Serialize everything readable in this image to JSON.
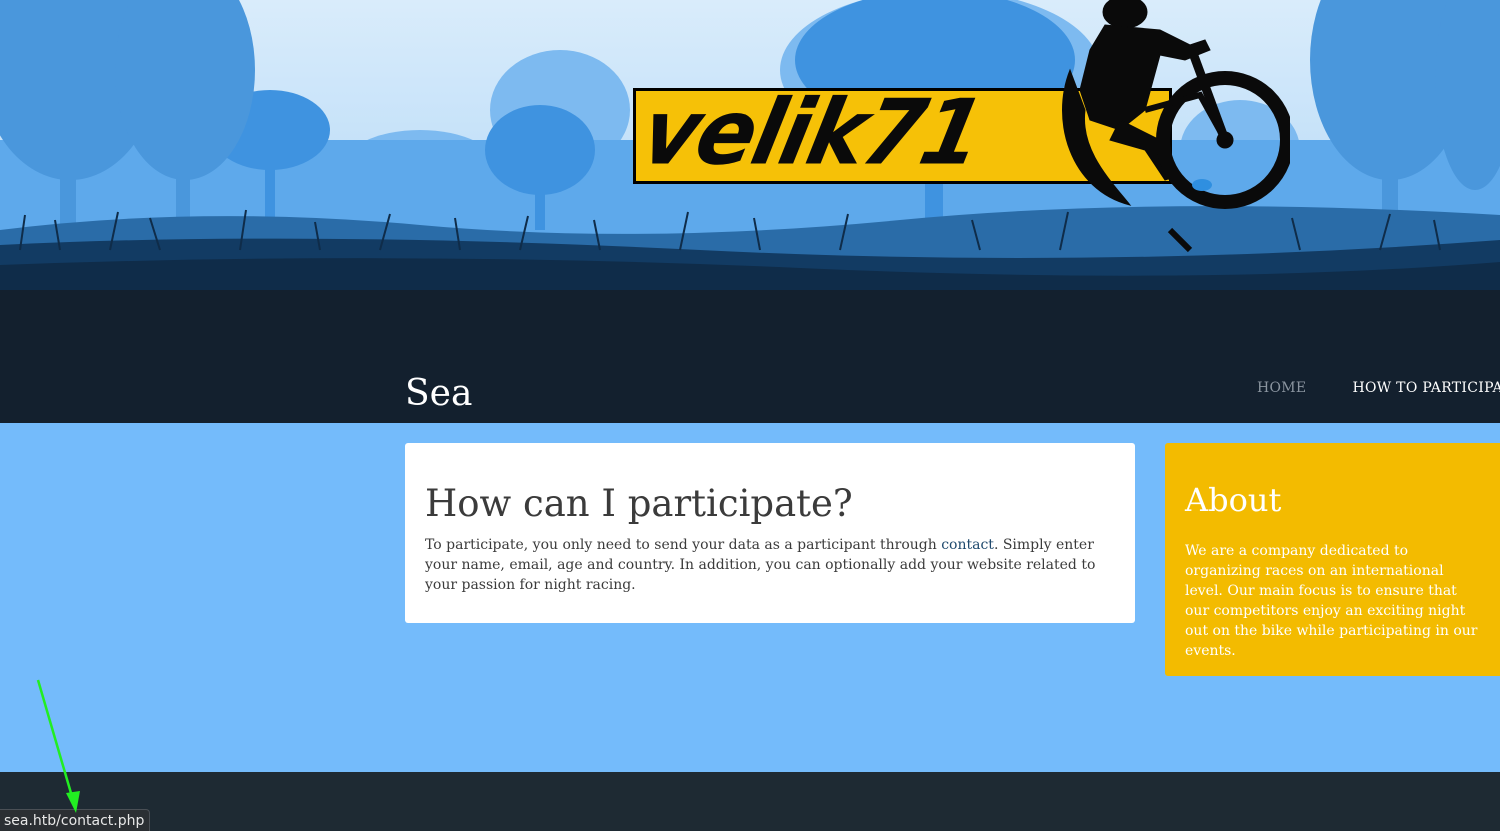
{
  "banner": {
    "logo_text": "velik71"
  },
  "header": {
    "site_title": "Sea",
    "nav": {
      "home": "HOME",
      "how_to_participate": "HOW TO PARTICIPATE"
    }
  },
  "main": {
    "heading": "How can I participate?",
    "text_before_link": "To participate, you only need to send your data as a participant through ",
    "link_text": "contact",
    "text_after_link": ". Simply enter your name, email, age and country. In addition, you can optionally add your website related to your passion for night racing."
  },
  "sidebar": {
    "title": "About",
    "text": "We are a company dedicated to organizing races on an international level. Our main focus is to ensure that our competitors enjoy an exciting night out on the bike while participating in our events."
  },
  "status_bar": {
    "url": "sea.htb/contact.php"
  },
  "colors": {
    "page_background": "#74bbfb",
    "header_dark": "#13202e",
    "about_panel": "#f3bb00",
    "logo_yellow": "#f6c107",
    "annotation_arrow": "#22ee22"
  }
}
